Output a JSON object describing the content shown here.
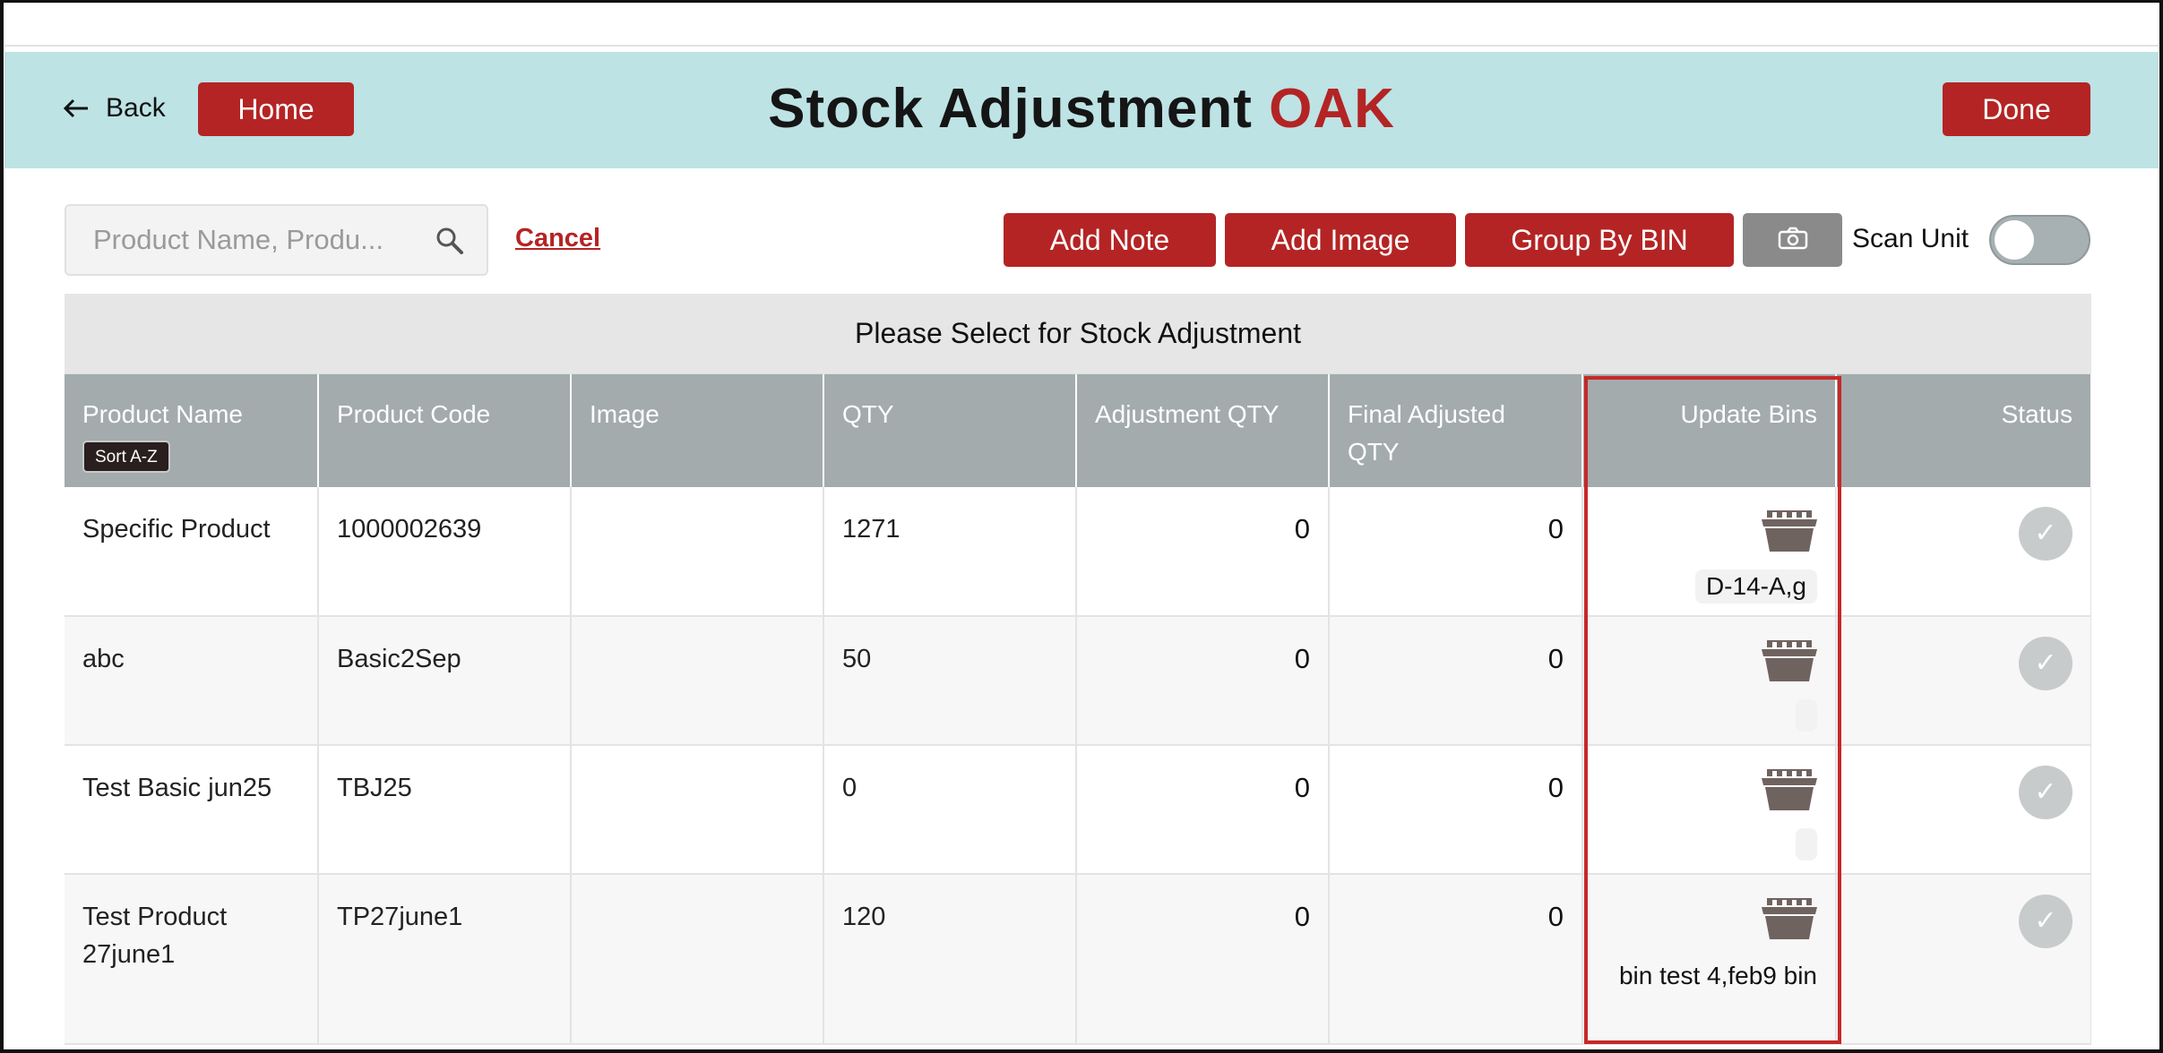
{
  "header": {
    "back_label": "Back",
    "home_label": "Home",
    "title": "Stock Adjustment",
    "title_accent": "OAK",
    "done_label": "Done"
  },
  "toolbar": {
    "search_placeholder": "Product Name, Produ...",
    "cancel_label": "Cancel",
    "add_note_label": "Add Note",
    "add_image_label": "Add Image",
    "group_by_bin_label": "Group By BIN",
    "scan_unit_label": "Scan Unit",
    "scan_unit_on": false
  },
  "panel": {
    "title": "Please Select for Stock Adjustment"
  },
  "table": {
    "columns": {
      "product_name": "Product Name",
      "sort": "Sort A-Z",
      "product_code": "Product Code",
      "image": "Image",
      "qty": "QTY",
      "adjustment_qty": "Adjustment QTY",
      "final_adjusted_qty": "Final Adjusted QTY",
      "update_bins": "Update Bins",
      "status": "Status"
    },
    "rows": [
      {
        "name": "Specific Product",
        "code": "1000002639",
        "qty": "1271",
        "adj": "0",
        "final": "0",
        "bins": "D-14-A,g"
      },
      {
        "name": "abc",
        "code": "Basic2Sep",
        "qty": "50",
        "adj": "0",
        "final": "0",
        "bins": ""
      },
      {
        "name": "Test Basic jun25",
        "code": "TBJ25",
        "qty": "0",
        "adj": "0",
        "final": "0",
        "bins": ""
      },
      {
        "name": "Test Product 27june1",
        "code": "TP27june1",
        "qty": "120",
        "adj": "0",
        "final": "0",
        "bins": "bin test 4,feb9 bin"
      }
    ]
  },
  "colors": {
    "accent_red": "#b42424",
    "header_bg": "#bde3e5",
    "column_header_bg": "#a3abad",
    "highlight_border": "#c62828"
  }
}
